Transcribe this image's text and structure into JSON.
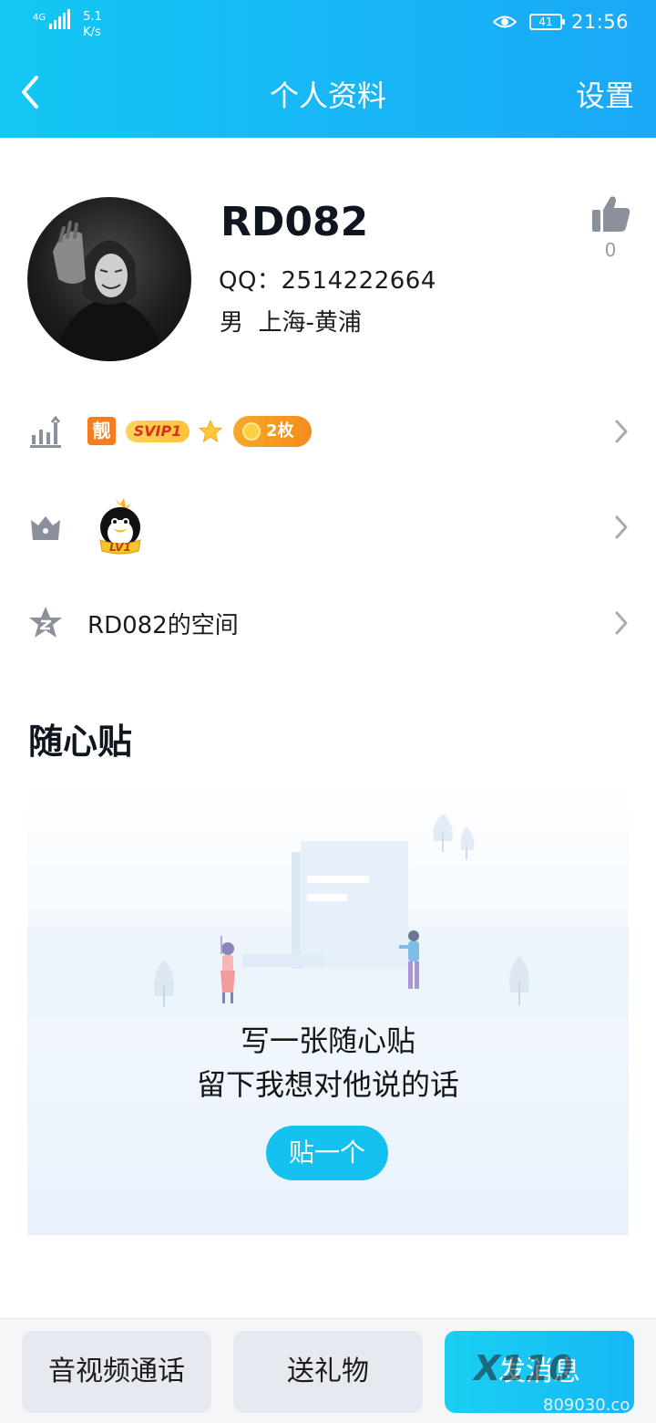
{
  "status_bar": {
    "network": "4G",
    "speed_value": "5.1",
    "speed_unit": "K/s",
    "battery": "41",
    "time": "21:56"
  },
  "nav": {
    "title": "个人资料",
    "settings_label": "设置"
  },
  "profile": {
    "nickname": "RD082",
    "qq_label": "QQ：",
    "qq_number": "2514222664",
    "gender": "男",
    "location": "上海-黄浦",
    "like_count": "0"
  },
  "badges": {
    "liang": "靓",
    "svip": "SVIP1",
    "coins": "2枚"
  },
  "qzone": {
    "label": "RD082的空间"
  },
  "sticky_note": {
    "section_title": "随心贴",
    "line1": "写一张随心贴",
    "line2": "留下我想对他说的话",
    "button": "贴一个"
  },
  "bottom_bar": {
    "call": "音视频通话",
    "gift": "送礼物",
    "message": "发消息"
  },
  "watermark": {
    "text": "X110",
    "url": "809030.co"
  },
  "colors": {
    "header_start": "#13c7f3",
    "header_end": "#1aa8f7",
    "accent": "#14c1ef",
    "coin_badge": "#f48c1b"
  }
}
